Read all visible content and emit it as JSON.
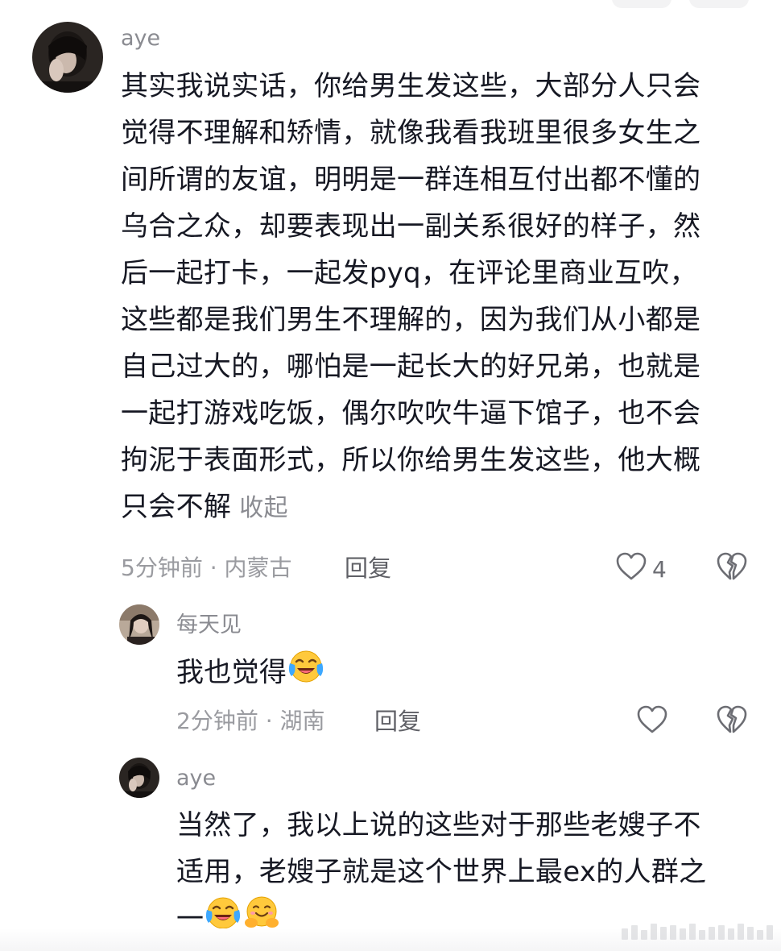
{
  "comments": [
    {
      "username": "aye",
      "lines": [
        "其实我说实话，你给男生发这些，大部分人只会",
        "觉得不理解和矫情，就像我看我班里很多女生之",
        "间所谓的友谊，明明是一群连相互付出都不懂的",
        "乌合之众，却要表现出一副关系很好的样子，然",
        "后一起打卡，一起发pyq，在评论里商业互吹，",
        "这些都是我们男生不理解的，因为我们从小都是",
        "自己过大的，哪怕是一起长大的好兄弟，也就是",
        "一起打游戏吃饭，偶尔吹吹牛逼下馆子，也不会",
        "拘泥于表面形式，所以你给男生发这些，他大概",
        "只会不解"
      ],
      "collapse_label": "收起",
      "meta": "5分钟前 · 内蒙古",
      "reply_label": "回复",
      "like_count": "4"
    },
    {
      "username": "每天见",
      "text": "我也觉得",
      "meta": "2分钟前 · 湖南",
      "reply_label": "回复"
    },
    {
      "username": "aye",
      "lines": [
        "当然了，我以上说的这些对于那些老嫂子不",
        "适用，老嫂子就是这个世界上最ex的人群之",
        "一"
      ]
    }
  ],
  "icons": {
    "like": "heart-outline-icon",
    "dislike": "broken-heart-icon",
    "emoji_cry_laugh": "face-with-tears-of-joy-icon",
    "emoji_hug": "hugging-face-icon"
  },
  "colors": {
    "text": "#161823",
    "secondary": "#8a8b91",
    "icon": "#6c6d73"
  }
}
